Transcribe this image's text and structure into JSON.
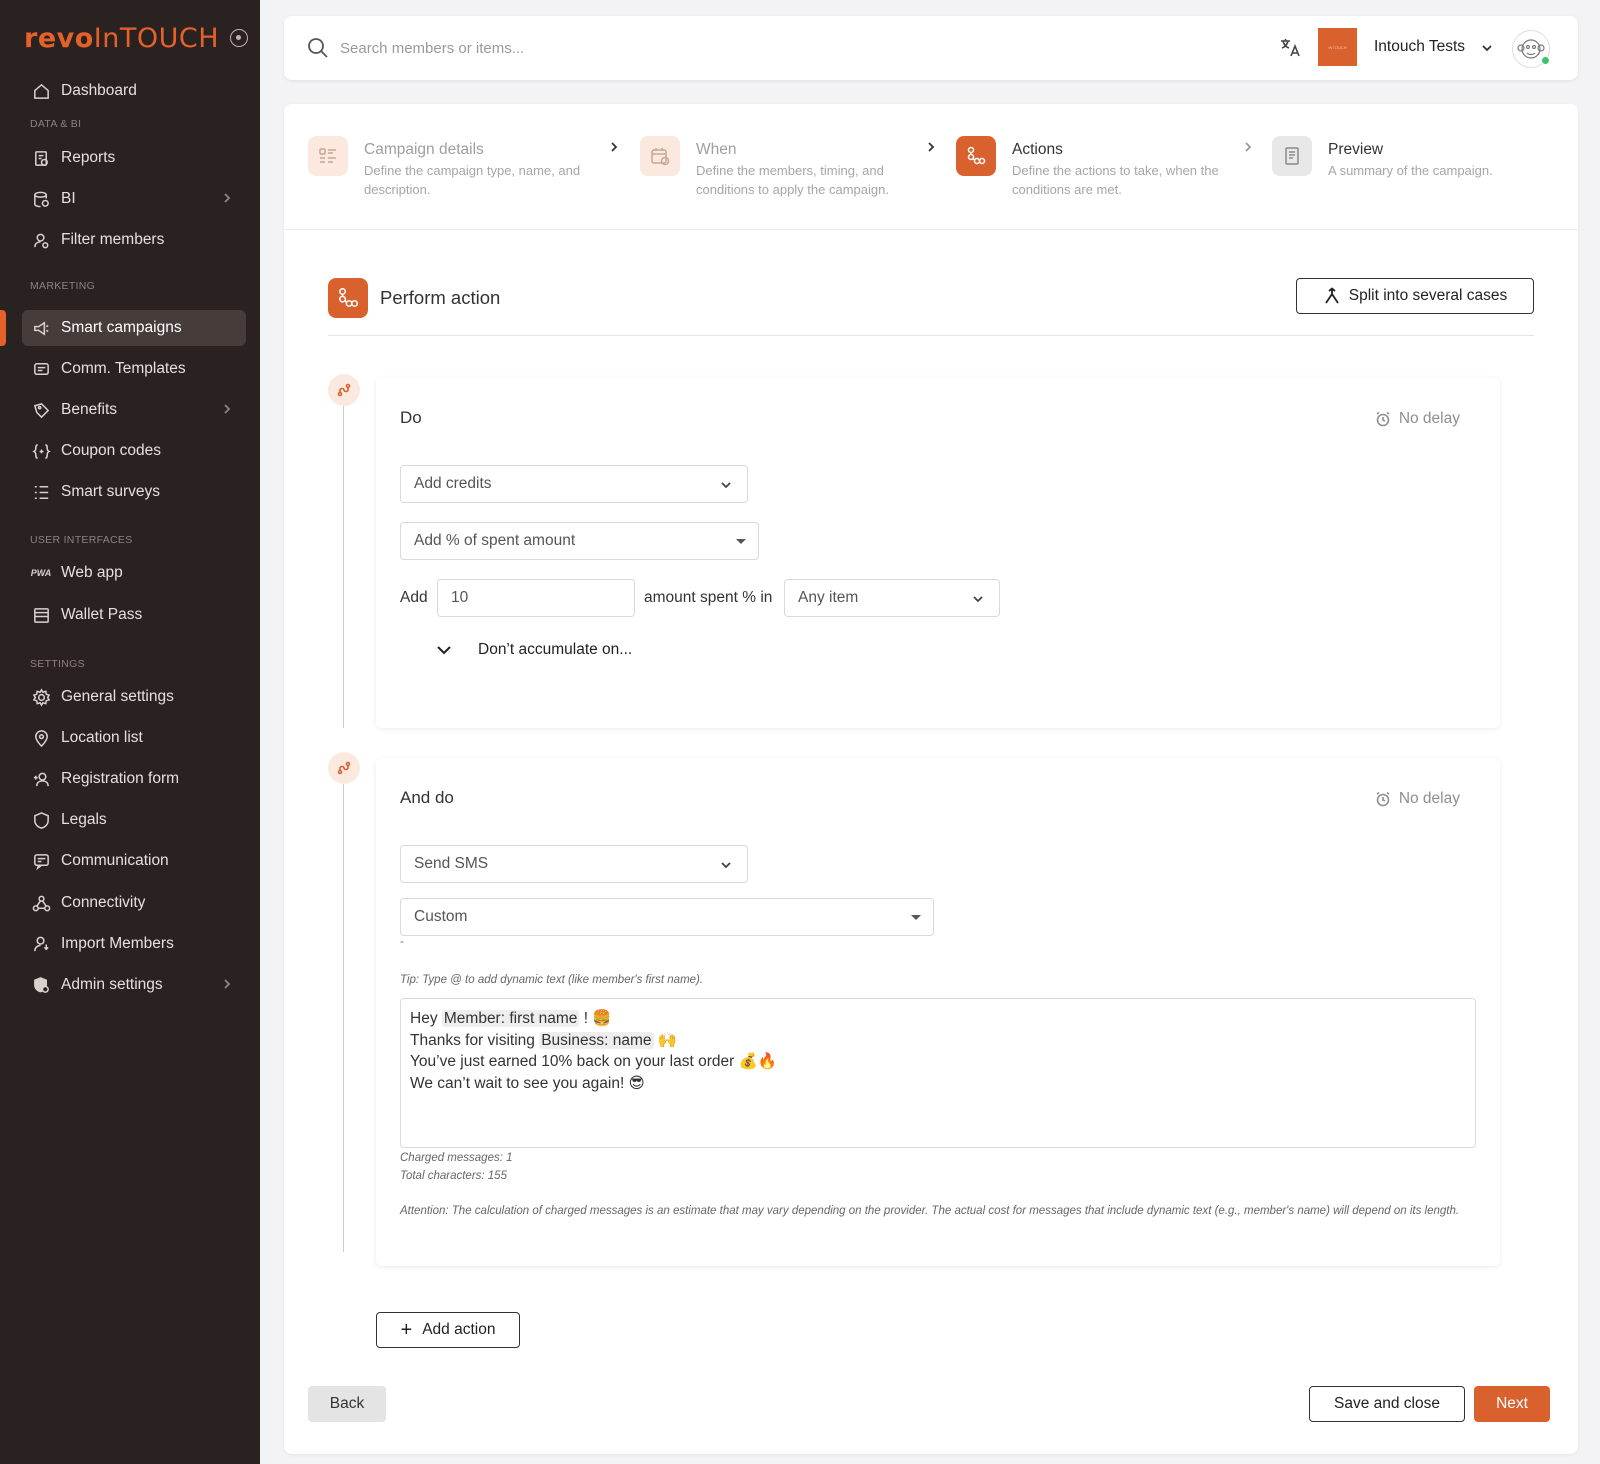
{
  "sidebar": {
    "logo_primary": "revo",
    "logo_secondary": "InTOUCH",
    "items": [
      {
        "label": "Dashboard",
        "icon": "home-icon"
      },
      {
        "label": "Reports",
        "icon": "reports-icon"
      },
      {
        "label": "BI",
        "icon": "database-icon"
      },
      {
        "label": "Filter members",
        "icon": "filter-members-icon"
      },
      {
        "label": "Smart campaigns",
        "icon": "megaphone-icon"
      },
      {
        "label": "Comm. Templates",
        "icon": "message-icon"
      },
      {
        "label": "Benefits",
        "icon": "tag-icon"
      },
      {
        "label": "Coupon codes",
        "icon": "coupon-icon"
      },
      {
        "label": "Smart surveys",
        "icon": "list-icon"
      },
      {
        "label": "Web app",
        "icon": "pwa-icon"
      },
      {
        "label": "Wallet Pass",
        "icon": "wallet-icon"
      },
      {
        "label": "General settings",
        "icon": "gear-icon"
      },
      {
        "label": "Location list",
        "icon": "location-icon"
      },
      {
        "label": "Registration form",
        "icon": "user-add-icon"
      },
      {
        "label": "Legals",
        "icon": "shield-icon"
      },
      {
        "label": "Communication",
        "icon": "communication-icon"
      },
      {
        "label": "Connectivity",
        "icon": "webhook-icon"
      },
      {
        "label": "Import Members",
        "icon": "import-user-icon"
      },
      {
        "label": "Admin settings",
        "icon": "admin-icon"
      }
    ],
    "sections": {
      "data_bi": "DATA & BI",
      "marketing": "MARKETING",
      "user_interfaces": "USER INTERFACES",
      "settings": "SETTINGS"
    },
    "pwa_text": "PWA"
  },
  "topbar": {
    "search_placeholder": "Search members or items...",
    "account_name": "Intouch Tests",
    "brand_thumb_text": "INTOUCH"
  },
  "stepper": [
    {
      "title": "Campaign details",
      "desc": "Define the campaign type, name, and description.",
      "state": "done"
    },
    {
      "title": "When",
      "desc": "Define the members, timing, and conditions to apply the campaign.",
      "state": "done"
    },
    {
      "title": "Actions",
      "desc": "Define the actions to take, when the conditions are met.",
      "state": "active"
    },
    {
      "title": "Preview",
      "desc": "A summary of the campaign.",
      "state": "pending"
    }
  ],
  "section": {
    "title": "Perform action",
    "split_label": "Split into several cases"
  },
  "action1": {
    "title": "Do",
    "delay": "No delay",
    "action_type": "Add credits",
    "credit_mode": "Add % of spent amount",
    "add_label": "Add",
    "amount_value": "10",
    "spent_label": "amount spent % in",
    "item_scope": "Any item",
    "accumulate_label": "Don’t accumulate on..."
  },
  "action2": {
    "title": "And do",
    "delay": "No delay",
    "action_type": "Send SMS",
    "template": "Custom",
    "dash": "-",
    "tip": "Tip: Type @ to add dynamic text (like member's first name).",
    "sms": {
      "l1_pre": "Hey ",
      "l1_chip": "Member: first name",
      "l1_post": " ! 🍔",
      "l2_pre": "Thanks for visiting ",
      "l2_chip": "Business: name",
      "l2_post": " 🙌",
      "l3": "You’ve just earned 10% back on your last order 💰🔥",
      "l4": "We can’t wait to see you again! 😎"
    },
    "charged": "Charged messages: 1",
    "total": "Total characters: 155",
    "attention": "Attention: The calculation of charged messages is an estimate that may vary depending on the provider. The actual cost for messages that include dynamic text (e.g., member's name) will depend on its length."
  },
  "footer": {
    "add_action": "Add action",
    "back": "Back",
    "save_close": "Save and close",
    "next": "Next"
  },
  "colors": {
    "accent": "#d9612e",
    "sidebar_bg": "#2a2220"
  }
}
